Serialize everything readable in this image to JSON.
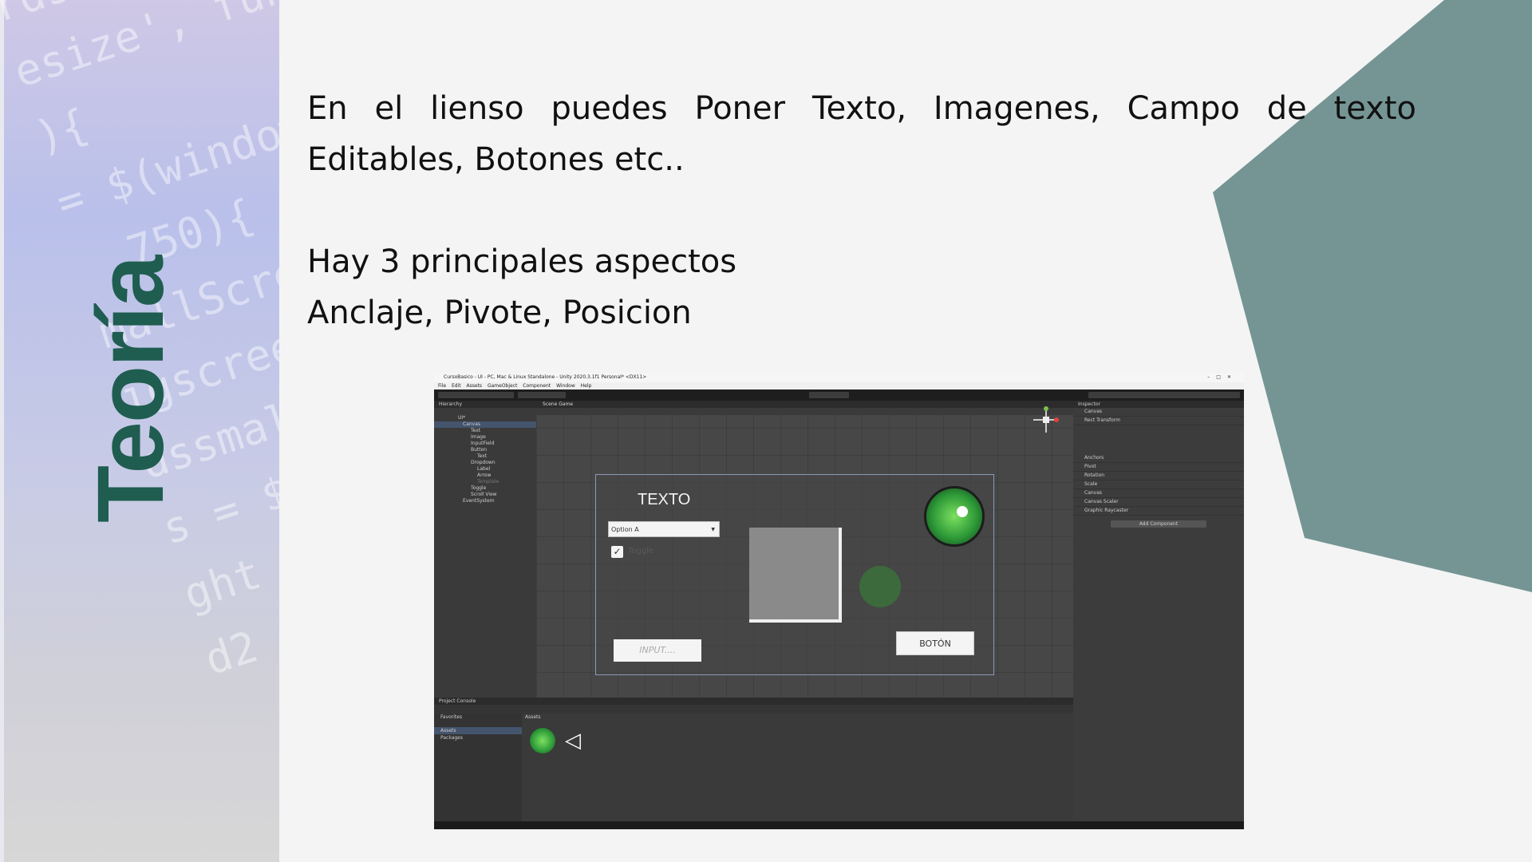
{
  "side_title": "Teoría",
  "intro_text": "En el lienso puedes Poner Texto, Imagenes, Campo de texto Editables, Botones etc..",
  "aspects_title": "Hay 3 principales aspectos",
  "aspects_list": "Anclaje, Pivote, Posicion",
  "colors": {
    "accent": "#1f5d50",
    "teal_shape": "#759594",
    "background": "#f4f4f4"
  },
  "screenshot": {
    "window_title": "CursoBasico - UI - PC, Mac & Linux Standalone - Unity 2020.3.1f1 Personal* <DX11>",
    "menu": [
      "File",
      "Edit",
      "Assets",
      "GameObject",
      "Component",
      "Window",
      "Help"
    ],
    "hierarchy_header": "Hierarchy",
    "hierarchy_items": [
      "UI*",
      "Canvas",
      "Text",
      "Image",
      "InputField",
      "Button",
      "Text",
      "Dropdown",
      "Label",
      "Arrow",
      "Template",
      "Toggle",
      "Scroll View",
      "EventSystem"
    ],
    "scene_tabs": "Scene    Game",
    "game_ui": {
      "text_label": "TEXTO",
      "dropdown_value": "Option A",
      "toggle_label": "Toggle",
      "toggle_check": "✓",
      "input_placeholder": "INPUT....",
      "button_label": "BOTÓN"
    },
    "inspector_header": "Inspector",
    "inspector_rows": [
      "Canvas",
      "Rect Transform",
      "Anchors",
      "Pivot",
      "Rotation",
      "Scale",
      "Canvas",
      "Canvas Scaler",
      "Graphic Raycaster"
    ],
    "add_component": "Add Component",
    "project_tabs": "Project    Console",
    "project_tree": [
      "Favorites",
      "Assets",
      "Packages"
    ],
    "assets_header": "Assets"
  }
}
